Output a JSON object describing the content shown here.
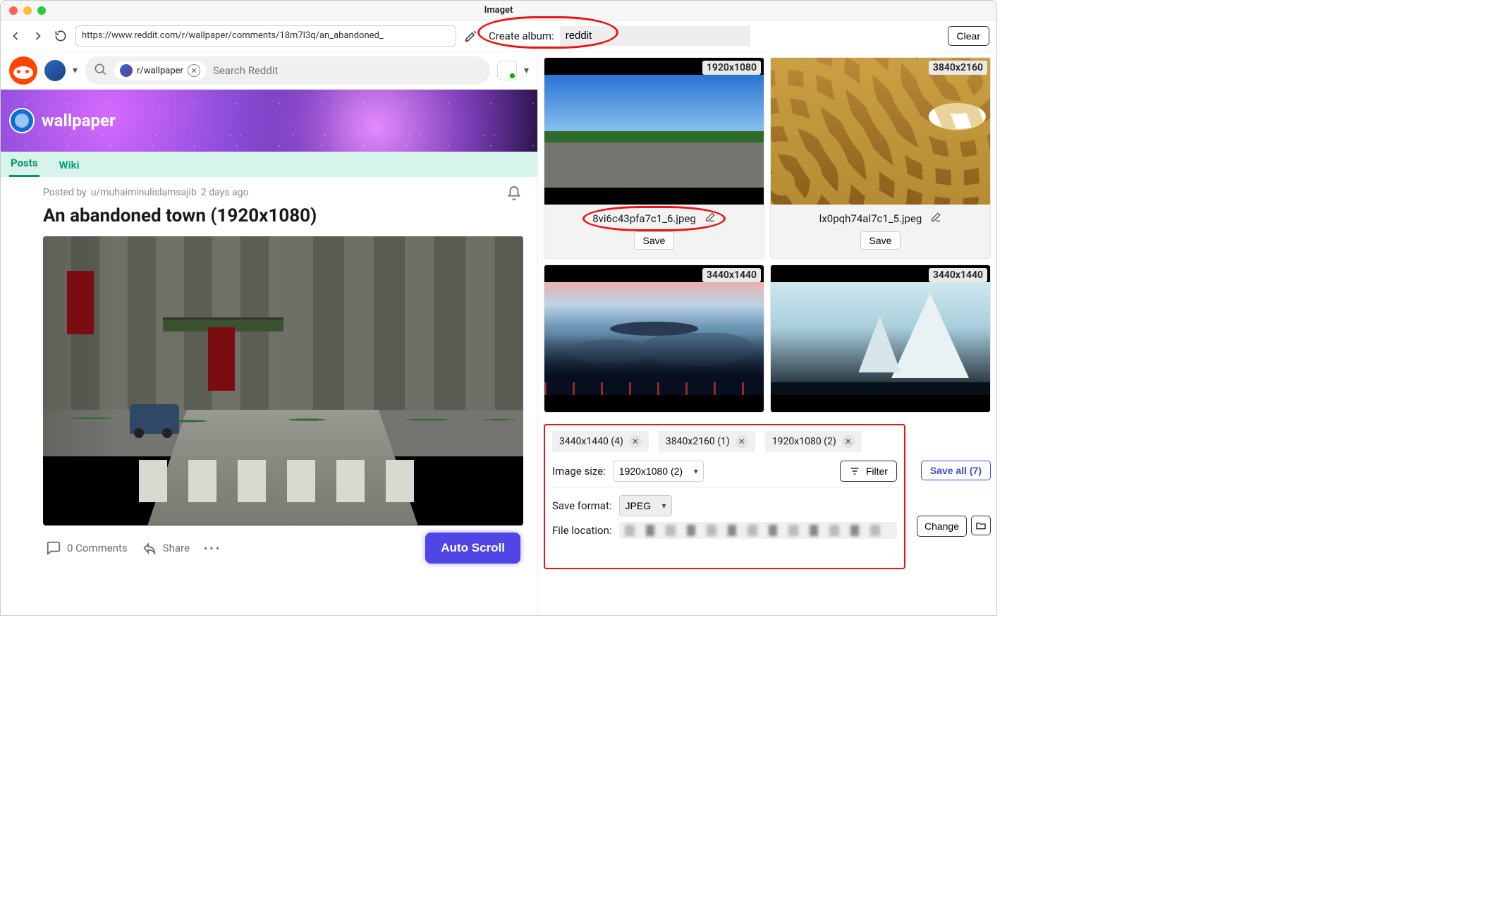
{
  "window": {
    "title": "Imaget"
  },
  "toolbar": {
    "url": "https://www.reddit.com/r/wallpaper/comments/18m7l3q/an_abandoned_",
    "album_label": "Create album:",
    "album_value": "reddit",
    "clear": "Clear"
  },
  "reddit": {
    "sub_chip": "r/wallpaper",
    "search_placeholder": "Search Reddit",
    "banner_name": "wallpaper",
    "tabs": [
      "Posts",
      "Wiki"
    ],
    "active_tab": 0
  },
  "post": {
    "prefix": "Posted by",
    "author": "u/muhaiminulislamsajib",
    "age": "2 days ago",
    "title": "An abandoned town (1920x1080)",
    "comments": "0 Comments",
    "share": "Share",
    "autoscroll": "Auto Scroll"
  },
  "thumbs": [
    {
      "dim": "1920x1080",
      "filename": "8vi6c43pfa7c1_6.jpeg",
      "save": "Save",
      "annot": true
    },
    {
      "dim": "3840x2160",
      "filename": "lx0pqh74al7c1_5.jpeg",
      "save": "Save",
      "annot": false
    },
    {
      "dim": "3440x1440"
    },
    {
      "dim": "3440x1440"
    }
  ],
  "filters": {
    "chips": [
      "3440x1440 (4)",
      "3840x2160 (1)",
      "1920x1080 (2)"
    ],
    "image_size_label": "Image size:",
    "image_size_value": "1920x1080 (2)",
    "filter_btn": "Filter",
    "save_all": "Save all (7)",
    "save_format_label": "Save format:",
    "save_format_value": "JPEG",
    "file_location_label": "File location:",
    "change": "Change"
  }
}
